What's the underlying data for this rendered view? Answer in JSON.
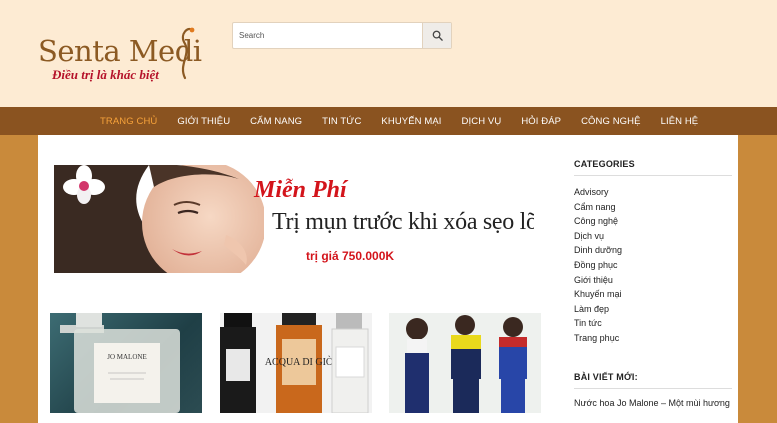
{
  "brand": {
    "name": "Senta Medi",
    "tagline": "Điều trị là khác biệt"
  },
  "search": {
    "placeholder": "Search"
  },
  "nav": {
    "items": [
      {
        "label": "TRANG CHỦ",
        "active": true
      },
      {
        "label": "GIỚI THIỆU"
      },
      {
        "label": "CẨM NANG"
      },
      {
        "label": "TIN TỨC"
      },
      {
        "label": "KHUYẾN MẠI"
      },
      {
        "label": "DỊCH VỤ"
      },
      {
        "label": "HỎI ĐÁP"
      },
      {
        "label": "CÔNG NGHỆ"
      },
      {
        "label": "LIÊN HỆ"
      }
    ]
  },
  "banner": {
    "title": "Miễn Phí",
    "subtitle": "Trị mụn trước khi xóa sẹo lõm",
    "price": "trị giá 750.000K"
  },
  "thumbs": {
    "perfume_label_1": "JO MALONE",
    "perfume_label_2": "ACQUA DI GIÒ"
  },
  "sidebar": {
    "categories_title": "CATEGORIES",
    "categories": [
      "Advisory",
      "Cẩm nang",
      "Công nghệ",
      "Dịch vụ",
      "Dinh dưỡng",
      "Đồng phục",
      "Giới thiệu",
      "Khuyến mại",
      "Làm đẹp",
      "Tin tức",
      "Trang phục"
    ],
    "recent_title": "BÀI VIẾT MỚI:",
    "recent_posts": [
      "Nước hoa Jo Malone – Một mùi hương"
    ]
  },
  "colors": {
    "header_bg": "#fdebd3",
    "nav_bg": "#8a5320",
    "nav_active": "#f6a23a",
    "page_bg": "#c98a3b",
    "accent_red": "#d3141b"
  }
}
